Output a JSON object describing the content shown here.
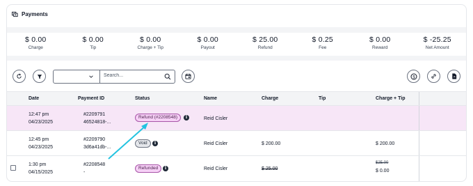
{
  "header": {
    "title": "Payments",
    "icon": "payments-icon"
  },
  "stats": [
    {
      "value": "$ 0.00",
      "label": "Charge"
    },
    {
      "value": "$ 0.00",
      "label": "Tip"
    },
    {
      "value": "$ 0.00",
      "label": "Charge + Tip"
    },
    {
      "value": "$ 0.00",
      "label": "Payout"
    },
    {
      "value": "$ 25.00",
      "label": "Refund"
    },
    {
      "value": "$ 0.25",
      "label": "Fee"
    },
    {
      "value": "$ 0.00",
      "label": "Reward"
    },
    {
      "value": "$ -25.25",
      "label": "Net Amount"
    }
  ],
  "toolbar": {
    "dropdown_value": "",
    "search_placeholder": "Search..."
  },
  "table": {
    "columns": [
      "Date",
      "Payment ID",
      "Status",
      "Name",
      "Charge",
      "Tip",
      "Charge + Tip"
    ],
    "rows": [
      {
        "time": "12:47 pm",
        "date": "04/23/2025",
        "id1": "#2209791",
        "id2": "46524818-...",
        "status": "Refund (#2208548)",
        "name": "Reid Cisler",
        "charge": "",
        "charge_tip": ""
      },
      {
        "time": "12:45 pm",
        "date": "04/23/2025",
        "id1": "#2209790",
        "id2": "3d6a41db-...",
        "status": "Void",
        "name": "Reid Cisler",
        "charge": "$ 200.00",
        "charge_tip": "$ 200.00"
      },
      {
        "time": "1:30 pm",
        "date": "04/15/2025",
        "id1": "#2208548",
        "id2": "-",
        "status": "Refunded",
        "name": "Reid Cisler",
        "charge": "$ 25.00",
        "charge_tip_old": "$25.00",
        "charge_tip": "$ 0.00"
      }
    ]
  },
  "colors": {
    "highlight_row": "#f7e6f7",
    "badge_refund": "#f5d0f5",
    "arrow": "#22c3e0"
  }
}
